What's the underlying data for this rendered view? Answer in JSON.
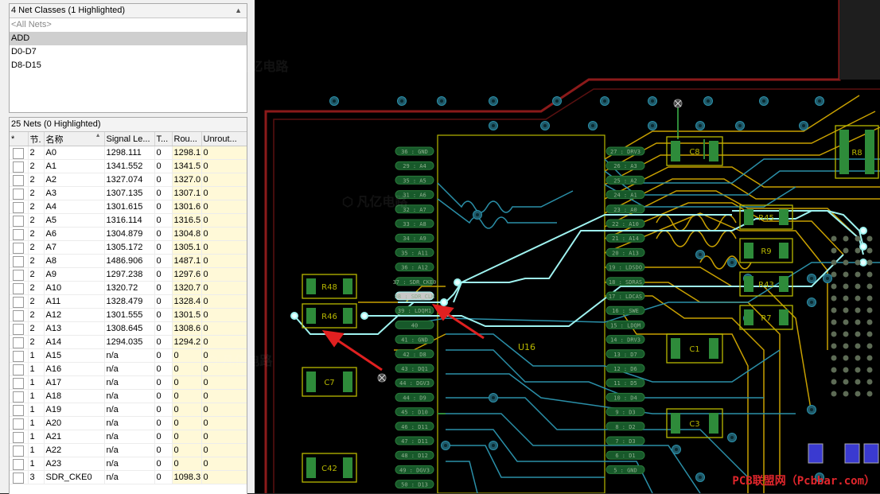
{
  "net_classes": {
    "header": "4 Net Classes (1 Highlighted)",
    "items": [
      {
        "label": "<All Nets>",
        "state": "muted"
      },
      {
        "label": "ADD",
        "state": "selected"
      },
      {
        "label": "D0-D7",
        "state": "normal"
      },
      {
        "label": "D8-D15",
        "state": "normal"
      }
    ]
  },
  "nets": {
    "header": "25 Nets (0 Highlighted)",
    "columns": [
      "*",
      "节.",
      "名称",
      "Signal Le...",
      "T...",
      "Rou...",
      "Unrout..."
    ],
    "rows": [
      {
        "n": "2",
        "name": "A0",
        "signal": "1298.111",
        "t": "0",
        "routed": "1298.1",
        "unrouted": "0"
      },
      {
        "n": "2",
        "name": "A1",
        "signal": "1341.552",
        "t": "0",
        "routed": "1341.5",
        "unrouted": "0"
      },
      {
        "n": "2",
        "name": "A2",
        "signal": "1327.074",
        "t": "0",
        "routed": "1327.0",
        "unrouted": "0"
      },
      {
        "n": "2",
        "name": "A3",
        "signal": "1307.135",
        "t": "0",
        "routed": "1307.1",
        "unrouted": "0"
      },
      {
        "n": "2",
        "name": "A4",
        "signal": "1301.615",
        "t": "0",
        "routed": "1301.6",
        "unrouted": "0"
      },
      {
        "n": "2",
        "name": "A5",
        "signal": "1316.114",
        "t": "0",
        "routed": "1316.5",
        "unrouted": "0"
      },
      {
        "n": "2",
        "name": "A6",
        "signal": "1304.879",
        "t": "0",
        "routed": "1304.8",
        "unrouted": "0"
      },
      {
        "n": "2",
        "name": "A7",
        "signal": "1305.172",
        "t": "0",
        "routed": "1305.1",
        "unrouted": "0"
      },
      {
        "n": "2",
        "name": "A8",
        "signal": "1486.906",
        "t": "0",
        "routed": "1487.1",
        "unrouted": "0"
      },
      {
        "n": "2",
        "name": "A9",
        "signal": "1297.238",
        "t": "0",
        "routed": "1297.6",
        "unrouted": "0"
      },
      {
        "n": "2",
        "name": "A10",
        "signal": "1320.72",
        "t": "0",
        "routed": "1320.7",
        "unrouted": "0"
      },
      {
        "n": "2",
        "name": "A11",
        "signal": "1328.479",
        "t": "0",
        "routed": "1328.4",
        "unrouted": "0"
      },
      {
        "n": "2",
        "name": "A12",
        "signal": "1301.555",
        "t": "0",
        "routed": "1301.5",
        "unrouted": "0"
      },
      {
        "n": "2",
        "name": "A13",
        "signal": "1308.645",
        "t": "0",
        "routed": "1308.6",
        "unrouted": "0"
      },
      {
        "n": "2",
        "name": "A14",
        "signal": "1294.035",
        "t": "0",
        "routed": "1294.2",
        "unrouted": "0"
      },
      {
        "n": "1",
        "name": "A15",
        "signal": "n/a",
        "t": "0",
        "routed": "0",
        "unrouted": "0"
      },
      {
        "n": "1",
        "name": "A16",
        "signal": "n/a",
        "t": "0",
        "routed": "0",
        "unrouted": "0"
      },
      {
        "n": "1",
        "name": "A17",
        "signal": "n/a",
        "t": "0",
        "routed": "0",
        "unrouted": "0"
      },
      {
        "n": "1",
        "name": "A18",
        "signal": "n/a",
        "t": "0",
        "routed": "0",
        "unrouted": "0"
      },
      {
        "n": "1",
        "name": "A19",
        "signal": "n/a",
        "t": "0",
        "routed": "0",
        "unrouted": "0"
      },
      {
        "n": "1",
        "name": "A20",
        "signal": "n/a",
        "t": "0",
        "routed": "0",
        "unrouted": "0"
      },
      {
        "n": "1",
        "name": "A21",
        "signal": "n/a",
        "t": "0",
        "routed": "0",
        "unrouted": "0"
      },
      {
        "n": "1",
        "name": "A22",
        "signal": "n/a",
        "t": "0",
        "routed": "0",
        "unrouted": "0"
      },
      {
        "n": "1",
        "name": "A23",
        "signal": "n/a",
        "t": "0",
        "routed": "0",
        "unrouted": "0"
      },
      {
        "n": "3",
        "name": "SDR_CKE0",
        "signal": "n/a",
        "t": "0",
        "routed": "1098.3",
        "unrouted": "0"
      }
    ]
  },
  "pcb": {
    "designators": [
      "R48",
      "R46",
      "C7",
      "C42",
      "U16",
      "C8",
      "R8",
      "R45",
      "R9",
      "R43",
      "R7",
      "C1",
      "C3"
    ],
    "left_pins": [
      "36 : GND",
      "29 : A4",
      "35 : A5",
      "31 : A6",
      "32 : A7",
      "33 : A8",
      "34 : A9",
      "35 : A11",
      "36 : A12",
      "37 : SDR_CKE0",
      "38 : SDR_CLK",
      "39 : LDQM1",
      "40",
      "41 : GND",
      "42 : D8",
      "43 : DQ1",
      "44 : DGV3",
      "44 : D9",
      "45 : D10",
      "46 : D11",
      "47 : D11",
      "48 : D12",
      "49 : DGV3",
      "50 : D13"
    ],
    "right_pins": [
      "27 : DRV3",
      "26 : A3",
      "25 : A2",
      "24 : A1",
      "23 : A0",
      "22 : A10",
      "21 : A14",
      "20 : A13",
      "19 : LDSDO",
      "18 : SDRAS",
      "17 : LDCAS",
      "16 : SWE",
      "15 : LDQM",
      "14 : DRV3",
      "13 : D7",
      "12 : D6",
      "11 : D5",
      "10 : D4",
      "9 : D3",
      "8 : D2",
      "7 : D3",
      "6 : D1",
      "5 : GND"
    ],
    "brand": "PCB联盟网（Pcbbar.com）",
    "colors": {
      "board": "#000000",
      "outline": "#8b1a1a",
      "track_yellow": "#c8a000",
      "track_cyan": "#2a8fa8",
      "highlight": "#9ff3f0",
      "arrow": "#e02020",
      "silk": "#b8b800",
      "pad_green": "#2e8b3a"
    }
  }
}
